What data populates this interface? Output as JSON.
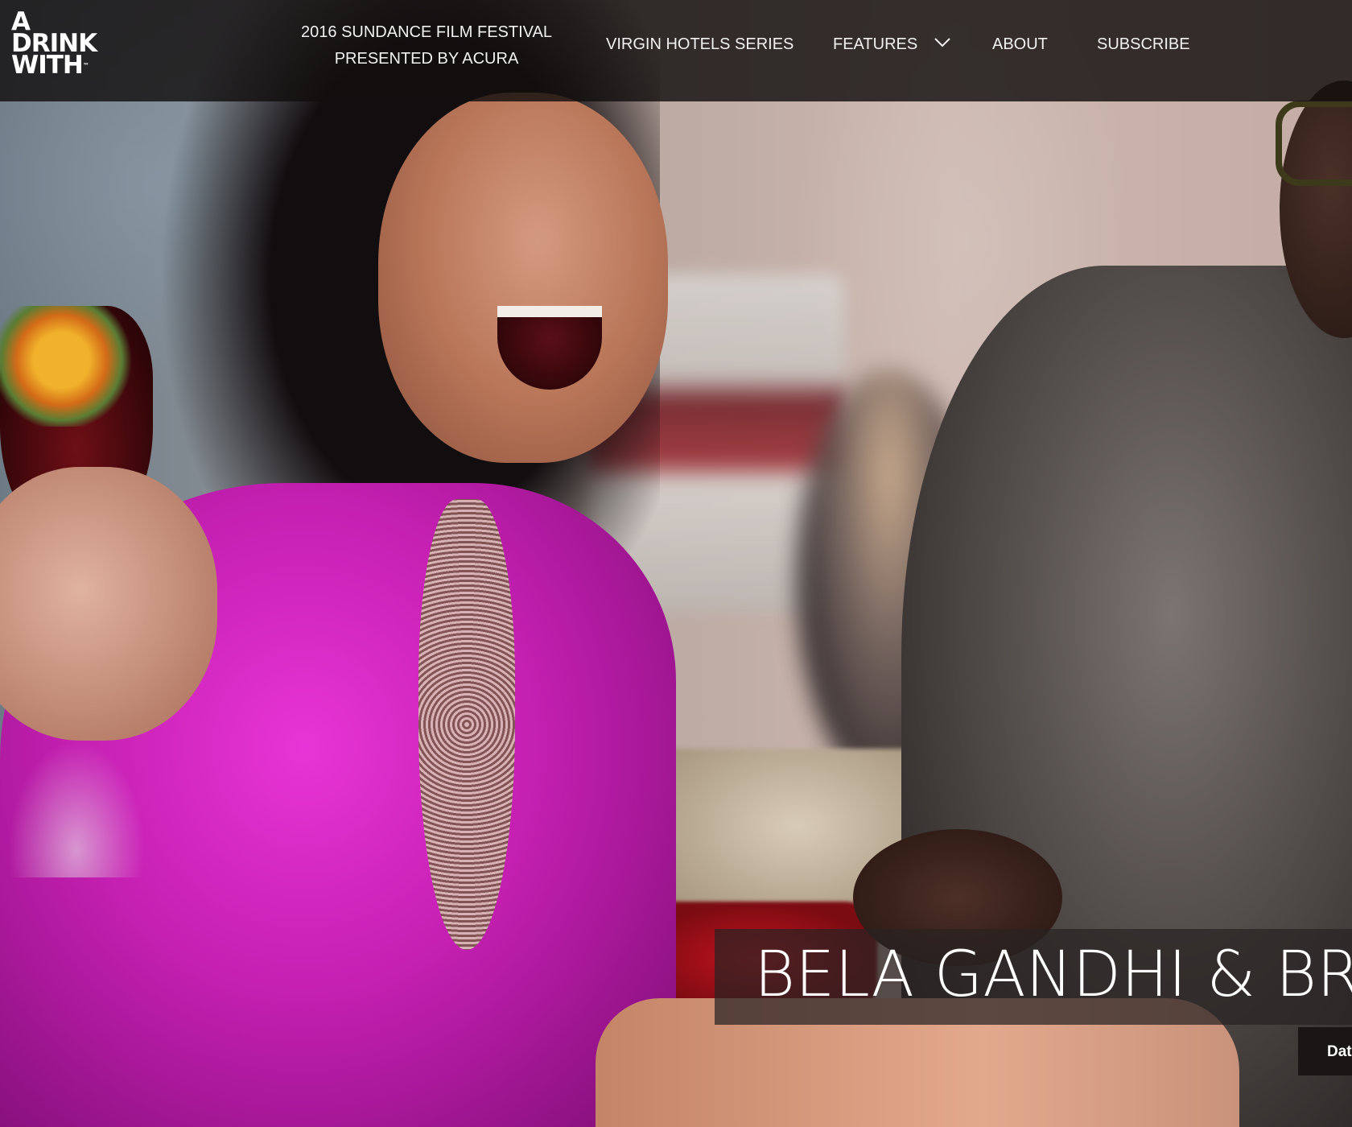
{
  "header": {
    "logo": {
      "line1": "A",
      "line2": "DRINK",
      "line3": "WITH",
      "trademark": "™"
    },
    "nav": {
      "festival_line1": "2016 SUNDANCE FILM FESTIVAL",
      "festival_line2": "PRESENTED BY ACURA",
      "virgin_hotels": "VIRGIN HOTELS SERIES",
      "features": "FEATURES",
      "features_icon": "chevron-down-icon",
      "about": "ABOUT",
      "subscribe": "SUBSCRIBE"
    }
  },
  "hero": {
    "title": "BELA GANDHI & BR",
    "date_tab": "Dat"
  },
  "colors": {
    "header_bg": "#120f0f",
    "nav_text": "#f1f1f1",
    "title_text": "#ffffff"
  }
}
